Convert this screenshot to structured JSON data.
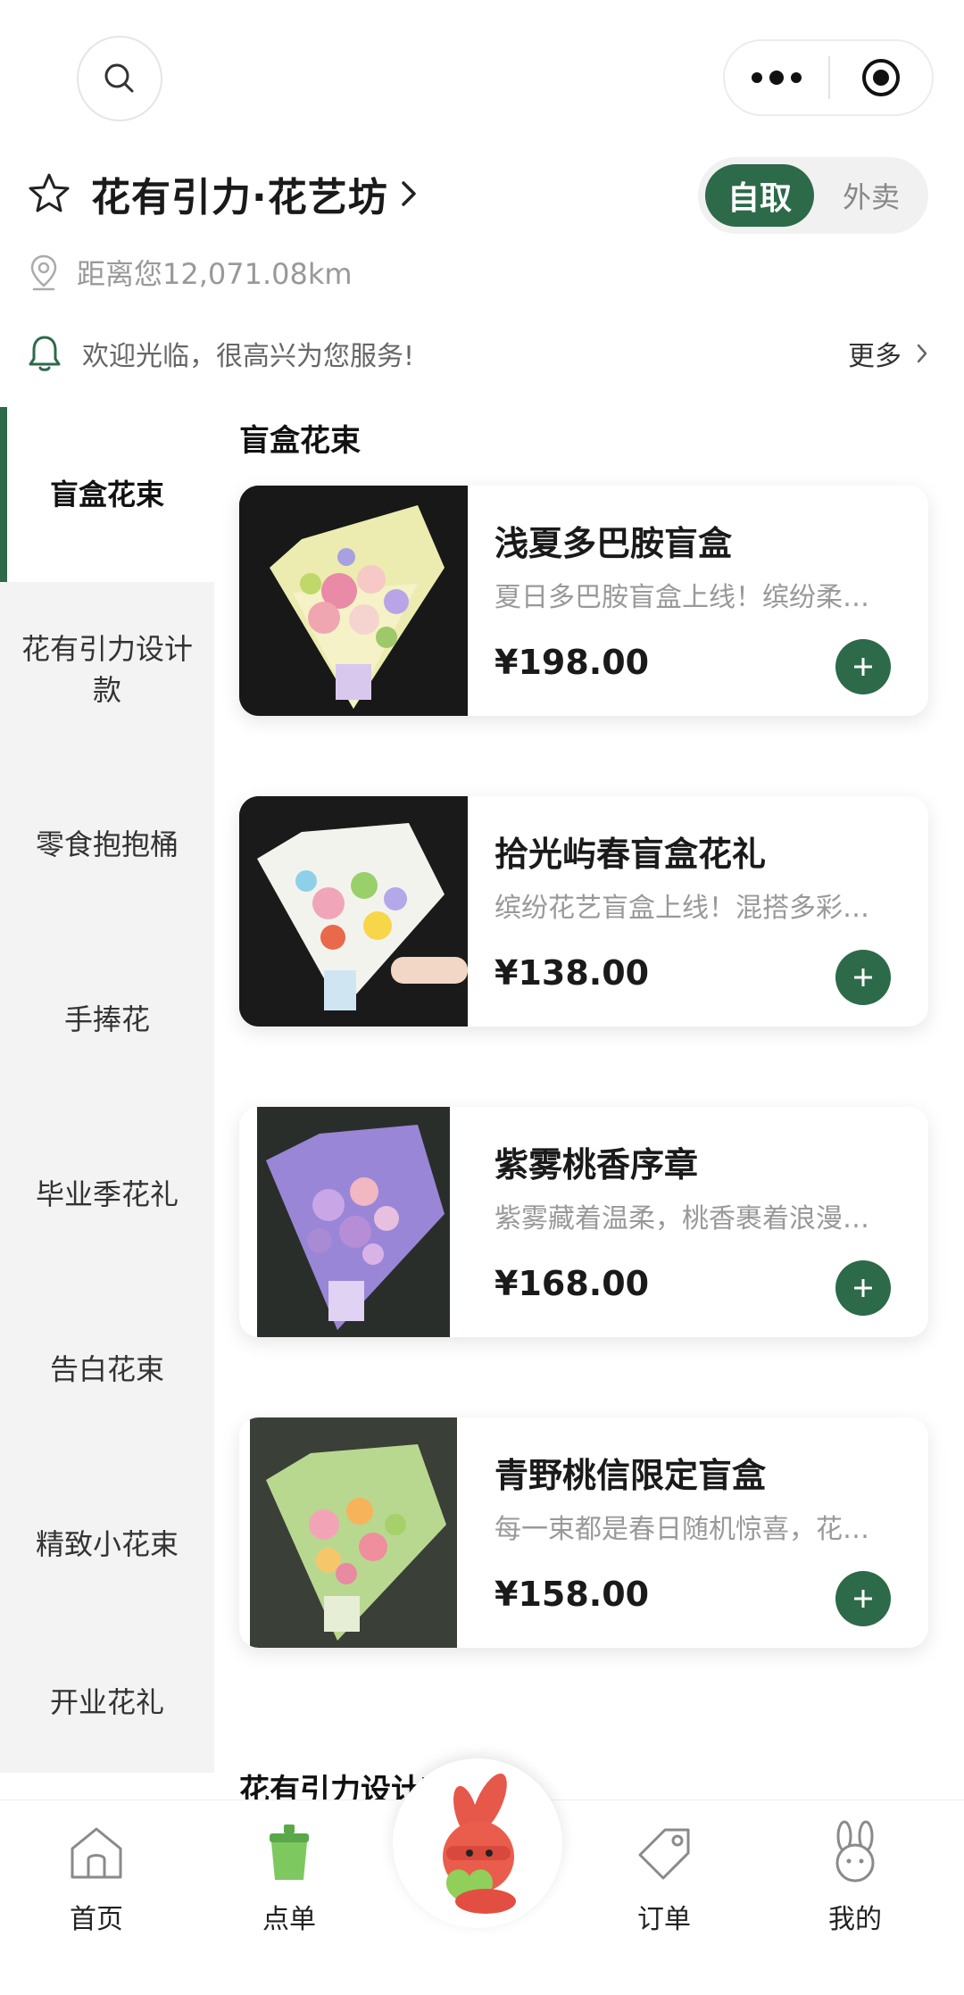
{
  "store": {
    "name": "花有引力·花艺坊",
    "distance": "距离您12,071.08km",
    "notice": "欢迎光临，很高兴为您服务!",
    "notice_more": "更多"
  },
  "mode_toggle": {
    "selected": "自取",
    "other": "外卖"
  },
  "sidebar": {
    "items": [
      {
        "label": "盲盒花束",
        "active": true
      },
      {
        "label": "花有引力设计款"
      },
      {
        "label": "零食抱抱桶"
      },
      {
        "label": "手捧花"
      },
      {
        "label": "毕业季花礼"
      },
      {
        "label": "告白花束"
      },
      {
        "label": "精致小花束"
      },
      {
        "label": "开业花礼"
      }
    ]
  },
  "sections": [
    {
      "title": "盲盒花束"
    },
    {
      "title": "花有引力设计款"
    }
  ],
  "products": [
    {
      "name": "浅夏多巴胺盲盒",
      "desc": "夏日多巴胺盲盒上线！缤纷柔…",
      "price": "¥198.00"
    },
    {
      "name": "拾光屿春盲盒花礼",
      "desc": "缤纷花艺盲盒上线！混搭多彩…",
      "price": "¥138.00"
    },
    {
      "name": "紫雾桃香序章",
      "desc": "紫雾藏着温柔，桃香裹着浪漫…",
      "price": "¥168.00"
    },
    {
      "name": "青野桃信限定盲盒",
      "desc": "每一束都是春日随机惊喜，花…",
      "price": "¥158.00"
    }
  ],
  "tabbar": {
    "items": [
      {
        "label": "首页",
        "icon": "house-icon"
      },
      {
        "label": "点单",
        "icon": "bucket-icon"
      },
      {
        "label": "订单",
        "icon": "tag-icon"
      },
      {
        "label": "我的",
        "icon": "bunny-icon"
      }
    ],
    "center_icon": "bunny-mascot-icon"
  },
  "colors": {
    "accent": "#2c6a4a",
    "sidebar_bg": "#f3f3f3",
    "muted_text": "#999999"
  }
}
